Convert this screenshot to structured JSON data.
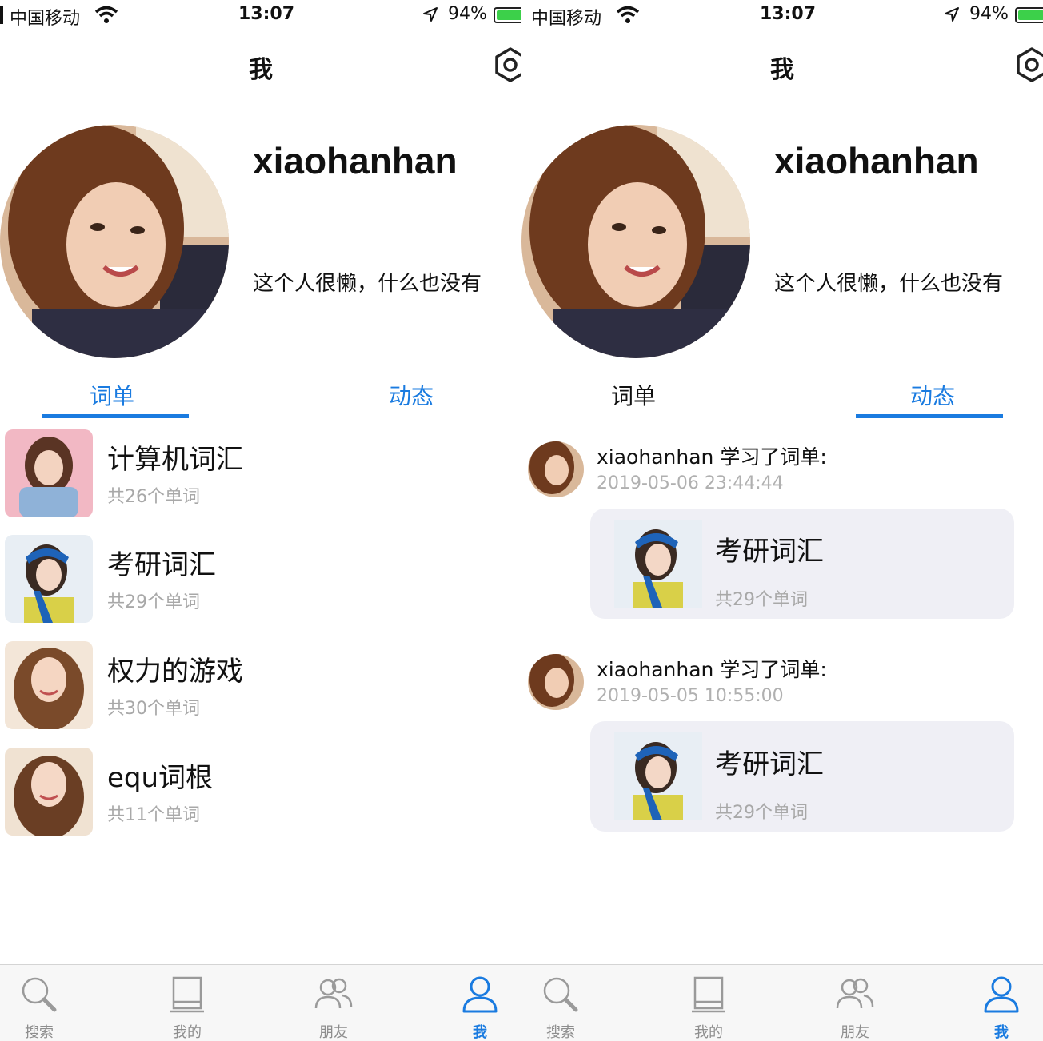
{
  "status": {
    "carrier": "中国移动",
    "time": "13:07",
    "battery": "94%"
  },
  "nav": {
    "title": "我"
  },
  "profile": {
    "username": "xiaohanhan",
    "bio": "这个人很懒，什么也没有"
  },
  "tabs": {
    "wordlists": "词单",
    "activity": "动态"
  },
  "wordlists": [
    {
      "title": "计算机词汇",
      "count": "共26个单词"
    },
    {
      "title": "考研词汇",
      "count": "共29个单词"
    },
    {
      "title": "权力的游戏",
      "count": "共30个单词"
    },
    {
      "title": "equ词根",
      "count": "共11个单词"
    }
  ],
  "activity": [
    {
      "text": "xiaohanhan 学习了词单:",
      "time": "2019-05-06 23:44:44",
      "card_title": "考研词汇",
      "card_count": "共29个单词"
    },
    {
      "text": "xiaohanhan 学习了词单:",
      "time": "2019-05-05 10:55:00",
      "card_title": "考研词汇",
      "card_count": "共29个单词"
    }
  ],
  "tabbar": {
    "search": "搜索",
    "mine": "我的",
    "friends": "朋友",
    "me": "我"
  },
  "colors": {
    "accent": "#1a7be0",
    "battery": "#3cd04a",
    "card_bg": "#efeff5"
  }
}
